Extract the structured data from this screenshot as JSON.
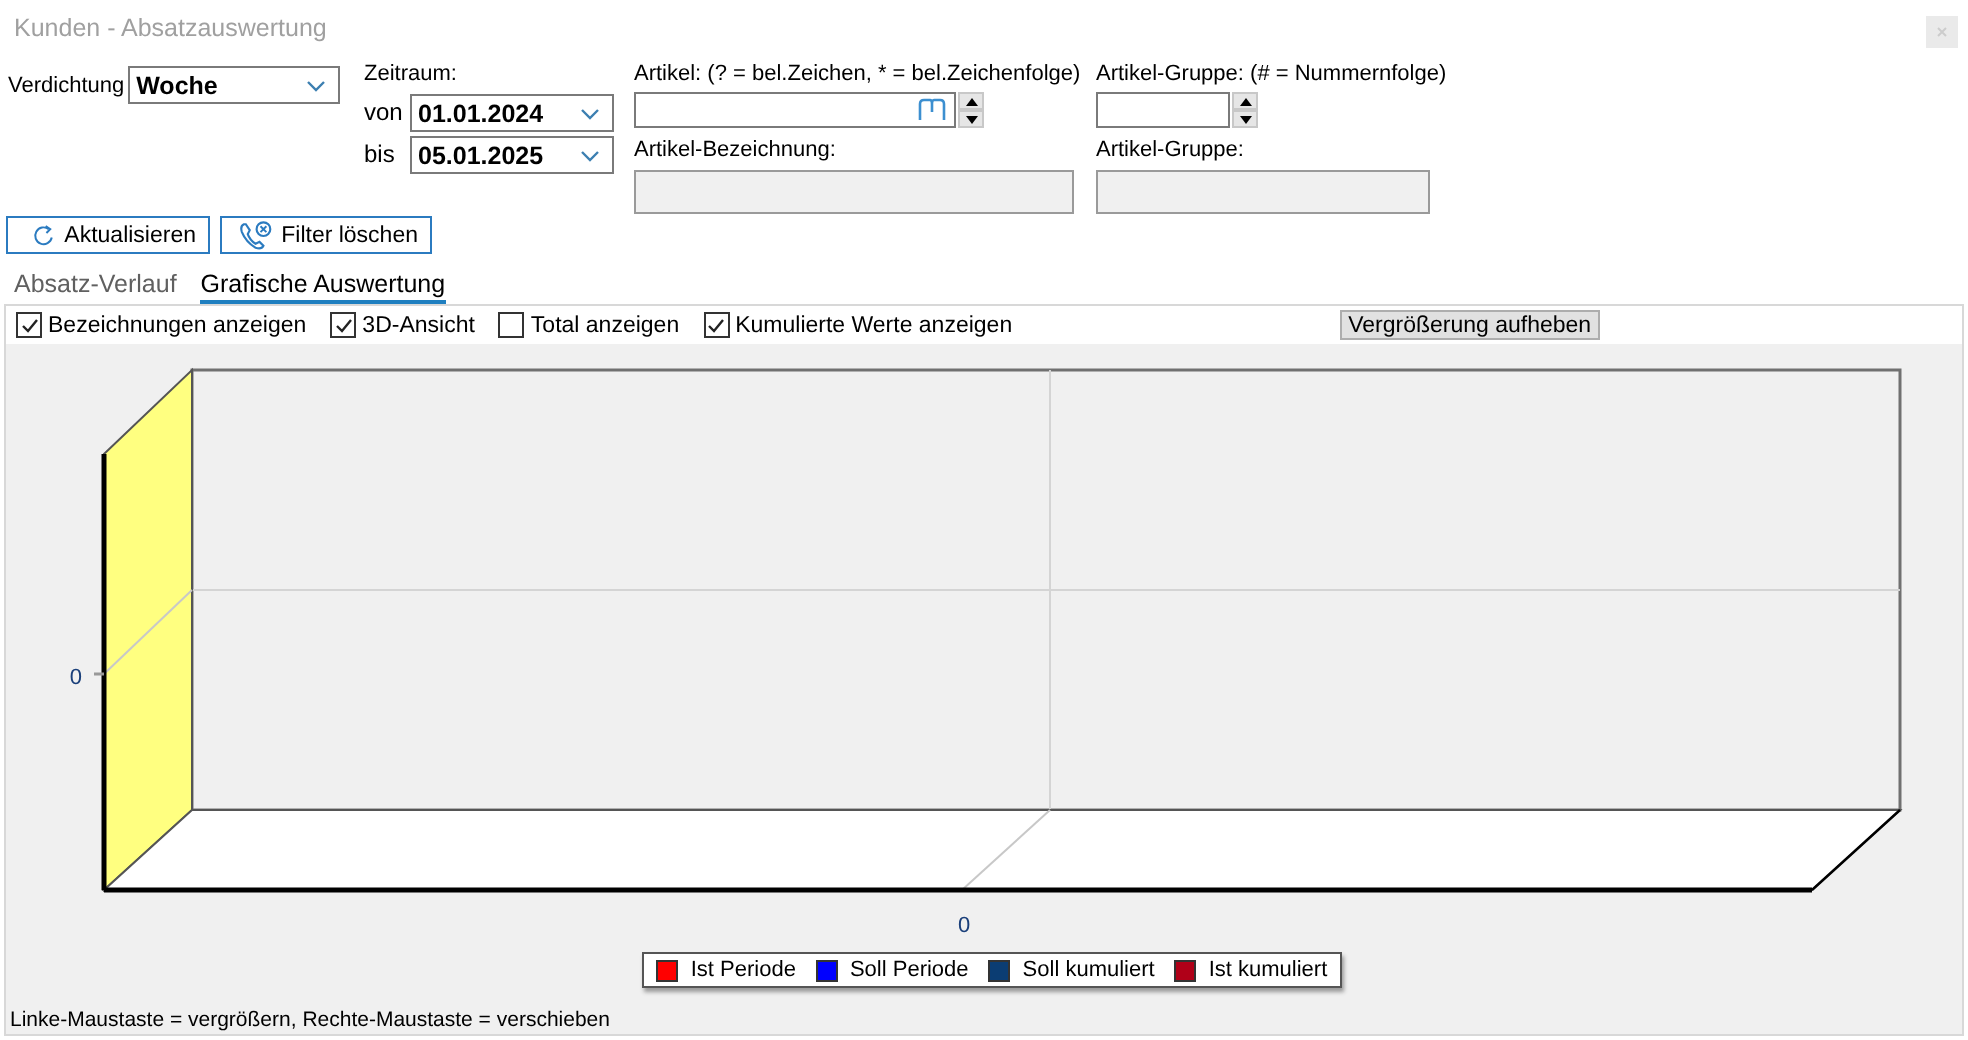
{
  "window": {
    "title": "Kunden - Absatzauswertung"
  },
  "verdichtung": {
    "label": "Verdichtung",
    "value": "Woche"
  },
  "zeitraum": {
    "label": "Zeitraum:",
    "from_label": "von",
    "from_value": "01.01.2024",
    "to_label": "bis",
    "to_value": "05.01.2025"
  },
  "artikel": {
    "label": "Artikel: (? = bel.Zeichen, * = bel.Zeichenfolge)",
    "description_label": "Artikel-Bezeichnung:"
  },
  "artikel_gruppe": {
    "label": "Artikel-Gruppe: (# = Nummernfolge)",
    "description_label": "Artikel-Gruppe:"
  },
  "buttons": [
    {
      "label": "Aktualisieren",
      "kind": "refresh"
    },
    {
      "label": "Filter löschen",
      "kind": "clear"
    }
  ],
  "tabs": [
    {
      "label": "Absatz-Verlauf",
      "selected": false
    },
    {
      "label": "Grafische Auswertung",
      "selected": true
    }
  ],
  "options": [
    {
      "label": "Bezeichnungen anzeigen",
      "checked": true
    },
    {
      "label": "3D-Ansicht",
      "checked": true
    },
    {
      "label": "Total anzeigen",
      "checked": false
    },
    {
      "label": "Kumulierte Werte anzeigen",
      "checked": true
    }
  ],
  "zoom_reset_button": "Vergrößerung aufheben",
  "chart": {
    "y_axis_label": "0",
    "x_axis_label": "0",
    "legend": [
      {
        "label": "Ist Periode",
        "color": "#ff0000"
      },
      {
        "label": "Soll Periode",
        "color": "#0000ff"
      },
      {
        "label": "Soll kumuliert",
        "color": "#0b3d73"
      },
      {
        "label": "Ist kumuliert",
        "color": "#b00018"
      }
    ],
    "hint": "Linke-Maustaste = vergrößern, Rechte-Maustaste = verschieben"
  }
}
